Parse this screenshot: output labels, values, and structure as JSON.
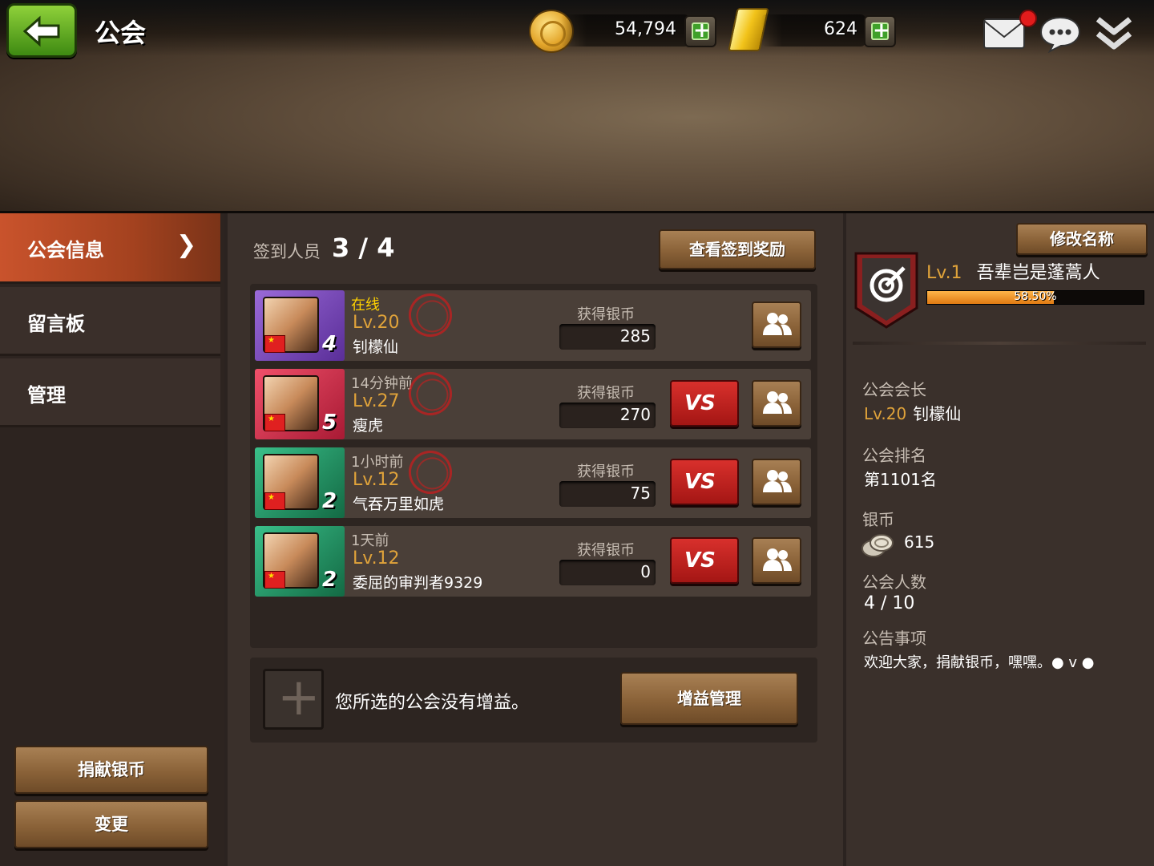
{
  "header": {
    "title": "公会",
    "silver_amount": "54,794",
    "gold_amount": "624"
  },
  "sidebar": {
    "items": [
      {
        "label": "公会信息"
      },
      {
        "label": "留言板"
      },
      {
        "label": "管理"
      }
    ],
    "donate_label": "捐献银币",
    "change_label": "变更"
  },
  "signin": {
    "label": "签到人员",
    "count": "3 / 4",
    "rewards_button": "查看签到奖励"
  },
  "members": [
    {
      "status": "在线",
      "level": "Lv.20",
      "name": "钊檬仙",
      "rank": "4",
      "earn_label": "获得银币",
      "earn": "285"
    },
    {
      "status": "14分钟前",
      "level": "Lv.27",
      "name": "瘦虎",
      "rank": "5",
      "earn_label": "获得银币",
      "earn": "270"
    },
    {
      "status": "1小时前",
      "level": "Lv.12",
      "name": "气吞万里如虎",
      "rank": "2",
      "earn_label": "获得银币",
      "earn": "75"
    },
    {
      "status": "1天前",
      "level": "Lv.12",
      "name": "委屈的审判者9329",
      "rank": "2",
      "earn_label": "获得银币",
      "earn": "0"
    }
  ],
  "buff": {
    "text": "您所选的公会没有增益。",
    "manage_button": "增益管理"
  },
  "guild": {
    "rename_button": "修改名称",
    "level": "Lv.1",
    "name": "吾辈岂是蓬蒿人",
    "progress_text": "58.50%",
    "progress": 0.585,
    "leader_label": "公会会长",
    "leader_level": "Lv.20",
    "leader_name": "钊檬仙",
    "rank_label": "公会排名",
    "rank_value": "第1101名",
    "silver_label": "银币",
    "silver_value": "615",
    "members_label": "公会人数",
    "members_value": "4 / 10",
    "notice_label": "公告事项",
    "notice_value": "欢迎大家，捐献银币，嘿嘿。● v ●"
  },
  "colors": {
    "accent_orange": "#e0a33a",
    "nav_active": "#c9532c",
    "online_status": "#ffd200",
    "row_purple": "#6a3ca8",
    "row_red": "#d8304a",
    "row_green": "#1e8a5a"
  }
}
